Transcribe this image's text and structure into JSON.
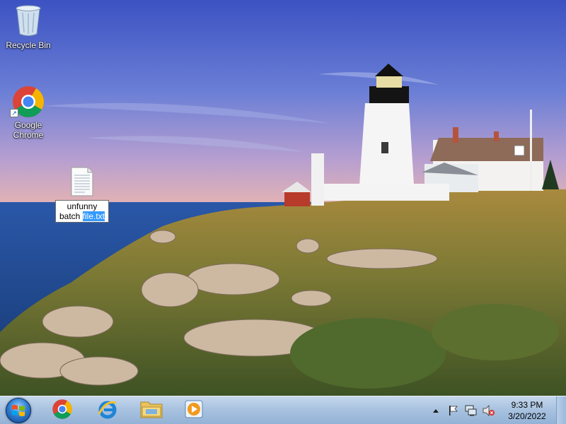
{
  "desktop": {
    "icons": [
      {
        "label": "Recycle Bin",
        "icon": "recycle-bin-icon"
      },
      {
        "label_line1": "Google",
        "label_line2": "Chrome",
        "icon": "chrome-icon"
      },
      {
        "label_line1": "unfunny",
        "label_prefix": "batch ",
        "label_selected": "file.txt",
        "icon": "text-file-icon",
        "state": "renaming"
      }
    ]
  },
  "taskbar": {
    "start_icon": "windows-logo-icon",
    "pinned": [
      {
        "name": "Google Chrome",
        "icon": "chrome-icon"
      },
      {
        "name": "Internet Explorer",
        "icon": "ie-icon"
      },
      {
        "name": "Windows Explorer",
        "icon": "folder-icon"
      },
      {
        "name": "Windows Media Player",
        "icon": "media-player-icon"
      }
    ],
    "tray": {
      "icons": [
        "show-hidden-icons-icon",
        "action-center-flag-icon",
        "network-icon",
        "volume-muted-icon"
      ],
      "time": "9:33 PM",
      "date": "3/20/2022"
    }
  },
  "colors": {
    "selection": "#3399ff",
    "taskbar_top": "#c6d8ec",
    "taskbar_bottom": "#93b2d6"
  }
}
